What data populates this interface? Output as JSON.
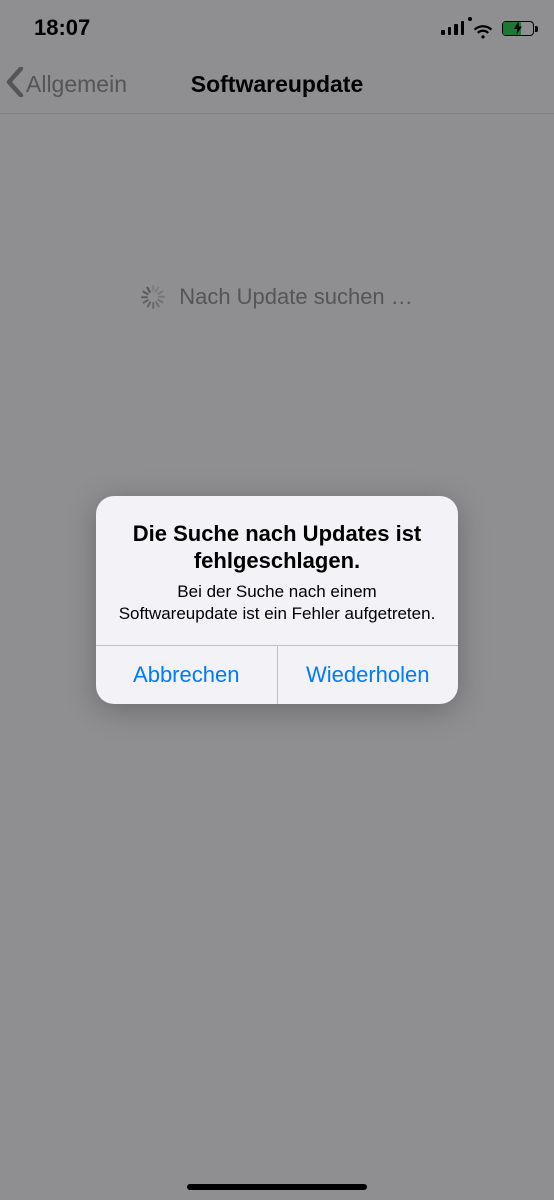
{
  "statusbar": {
    "time": "18:07"
  },
  "navbar": {
    "back_label": "Allgemein",
    "title": "Softwareupdate"
  },
  "content": {
    "searching_text": "Nach Update suchen …"
  },
  "alert": {
    "title": "Die Suche nach Updates ist fehlgeschlagen.",
    "message": "Bei der Suche nach einem Softwareupdate ist ein Fehler aufgetreten.",
    "cancel_label": "Abbrechen",
    "retry_label": "Wiederholen"
  }
}
